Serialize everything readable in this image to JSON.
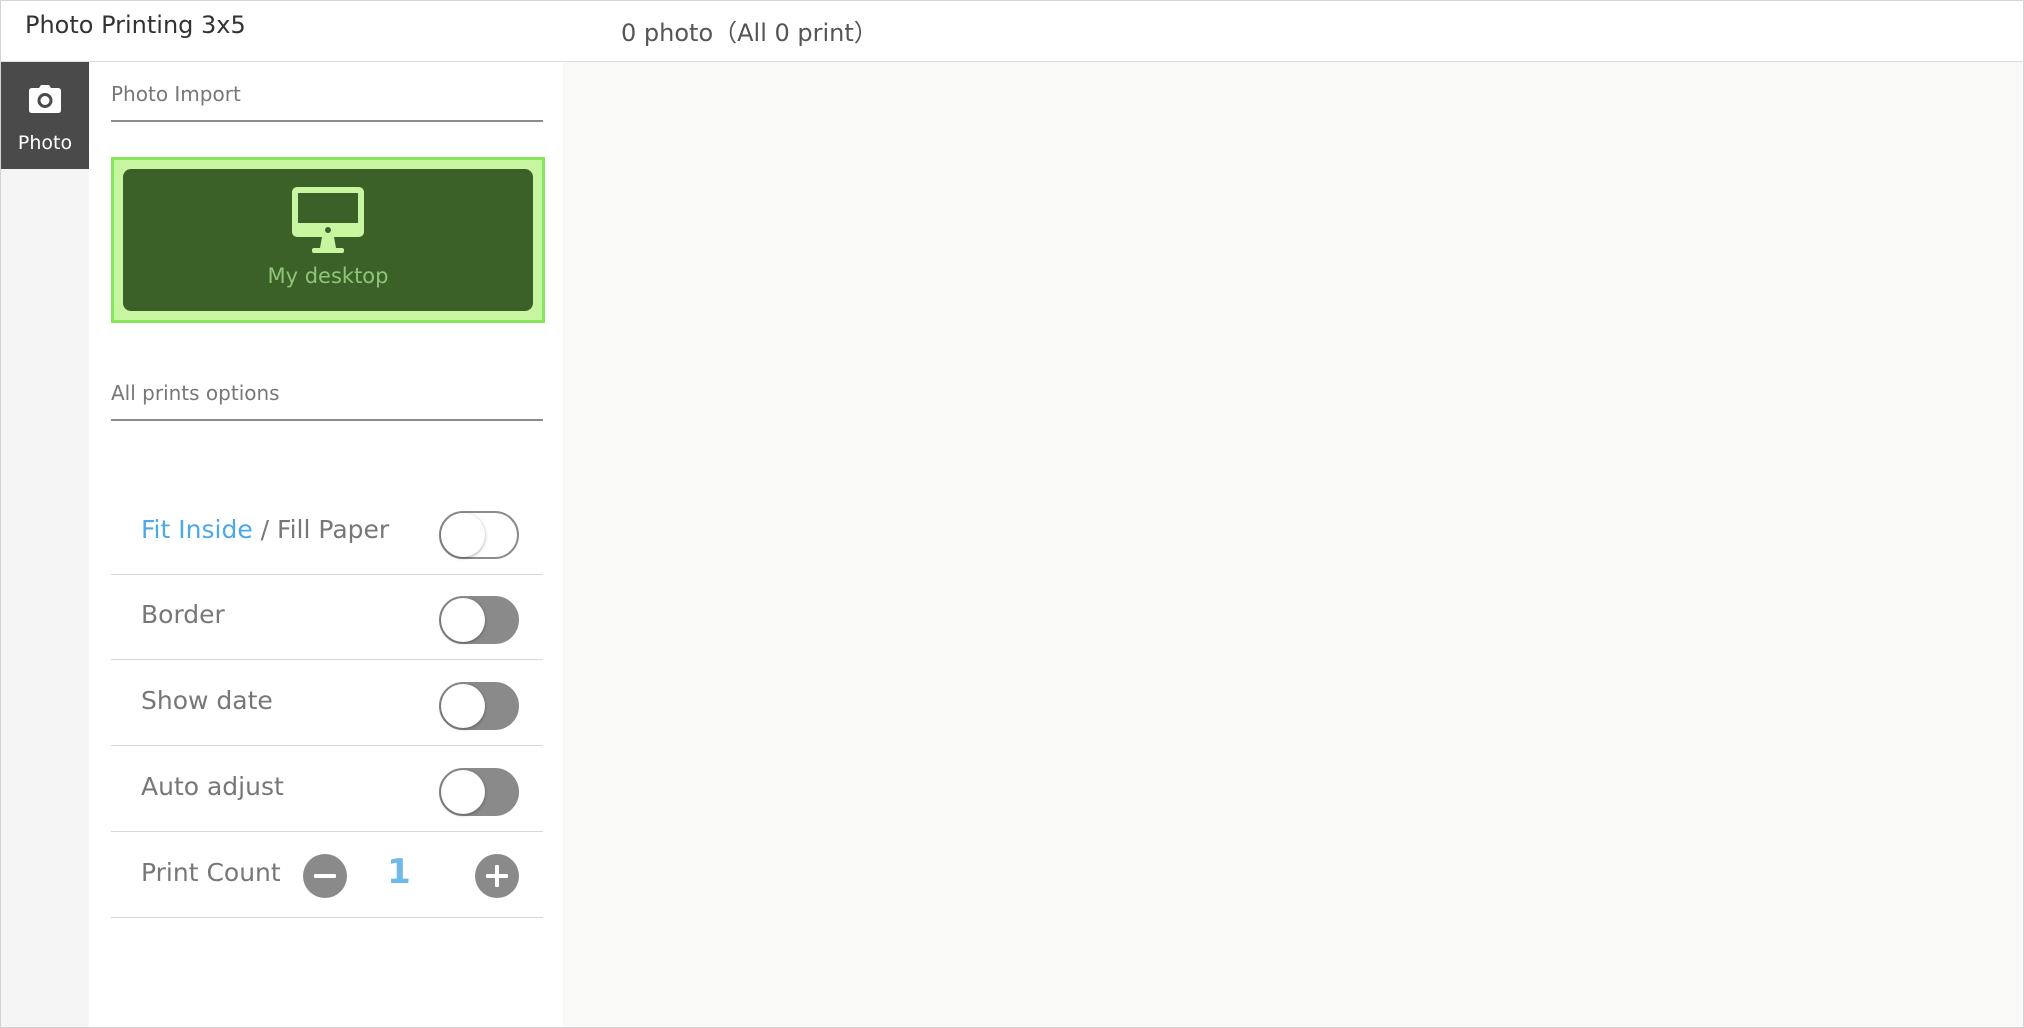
{
  "header": {
    "title": "Photo Printing 3x5",
    "summary": "0 photo（All 0 print）"
  },
  "rail": {
    "tabs": [
      {
        "label": "Photo",
        "icon": "camera-icon",
        "active": true
      }
    ]
  },
  "panel": {
    "import_title": "Photo Import",
    "import_button": {
      "label": "My desktop",
      "icon": "monitor-icon"
    },
    "options_title": "All prints options",
    "options": {
      "fit_inside": "Fit Inside",
      "separator": " / ",
      "fill_paper": "Fill Paper",
      "border": "Border",
      "show_date": "Show date",
      "auto_adjust": "Auto adjust",
      "print_count": "Print Count"
    },
    "print_count_value": "1"
  },
  "colors": {
    "accent_blue": "#4ca8e6",
    "import_bg": "#3c6128",
    "import_highlight": "#84e85a",
    "rail_active": "#4a4a4a"
  }
}
